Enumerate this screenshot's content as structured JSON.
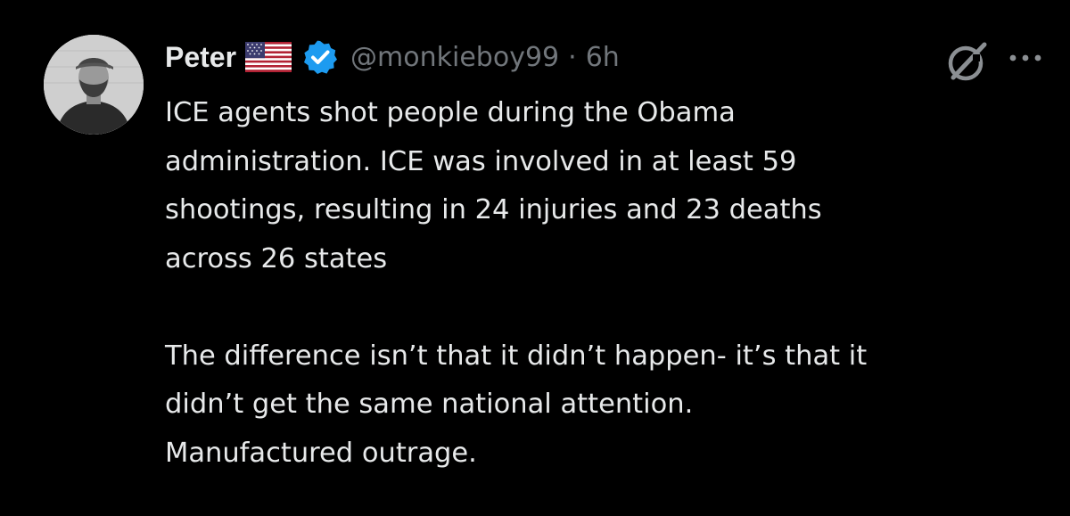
{
  "author": {
    "name": "Peter",
    "flag_icon": "us-flag-icon",
    "verified_icon": "verified-badge-icon",
    "verified_color": "#1d9bf0",
    "handle": "@monkieboy99",
    "separator": "·",
    "time": "6h"
  },
  "actions": {
    "grok_icon": "grok-icon",
    "more_icon": "more-options-icon"
  },
  "tweet": {
    "paragraphs": [
      {
        "lines": [
          "ICE agents shot people during the Obama",
          "administration. ICE was involved in at least 59",
          "shootings, resulting in 24 injuries and 23 deaths",
          "across 26 states"
        ]
      },
      {
        "lines": [
          "The difference isn’t that it didn’t happen- it’s that it",
          "didn’t get the same national attention.",
          "Manufactured outrage."
        ]
      }
    ]
  },
  "colors": {
    "background": "#000000",
    "text": "#e7e9ea",
    "muted": "#71767b"
  }
}
